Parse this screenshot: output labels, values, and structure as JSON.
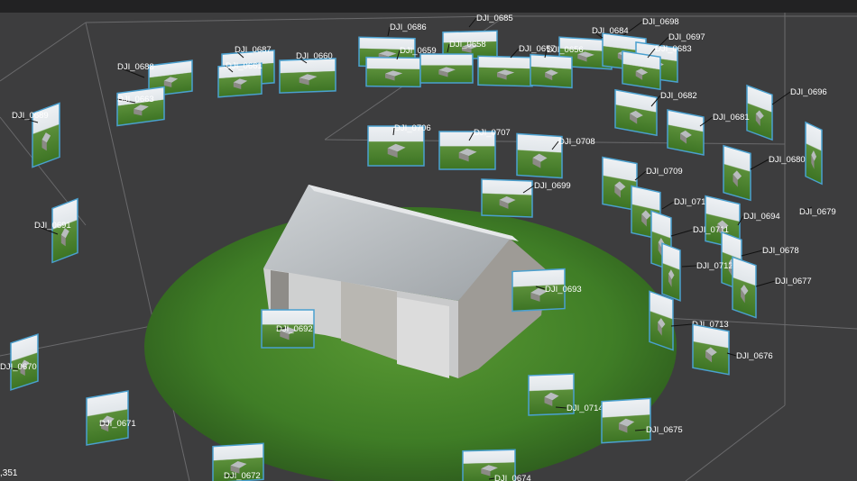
{
  "viewer": {
    "corner_value": ",351"
  },
  "colors": {
    "background": "#3d3d3e",
    "frame": "#4aa0cf",
    "sky": "#e4e9ee",
    "grass": "#4a8a2e",
    "label": "#ffffff"
  },
  "cameras": [
    "DJI_0685",
    "DJI_0686",
    "DJI_0698",
    "DJI_0684",
    "DJI_0697",
    "DJI_0683",
    "DJI_0687",
    "DJI_0660",
    "DJI_0688",
    "DJI_0661",
    "DJI_0659",
    "DJI_0658",
    "DJI_0657",
    "DJI_0656",
    "DJI_0663",
    "DJI_0682",
    "DJI_0696",
    "DJI_0689",
    "DJI_0681",
    "DJI_0706",
    "DJI_0707",
    "DJI_0708",
    "DJI_0680",
    "DJI_0709",
    "DJI_0699",
    "DJI_0710",
    "DJI_0694",
    "DJI_0679",
    "DJI_0691",
    "DJI_0711",
    "DJI_0678",
    "DJI_0712",
    "DJI_0693",
    "DJI_0677",
    "DJI_0692",
    "DJI_0713",
    "DJI_0670",
    "DJI_0676",
    "DJI_0714",
    "DJI_0671",
    "DJI_0675",
    "DJI_0672",
    "DJI_0674"
  ]
}
